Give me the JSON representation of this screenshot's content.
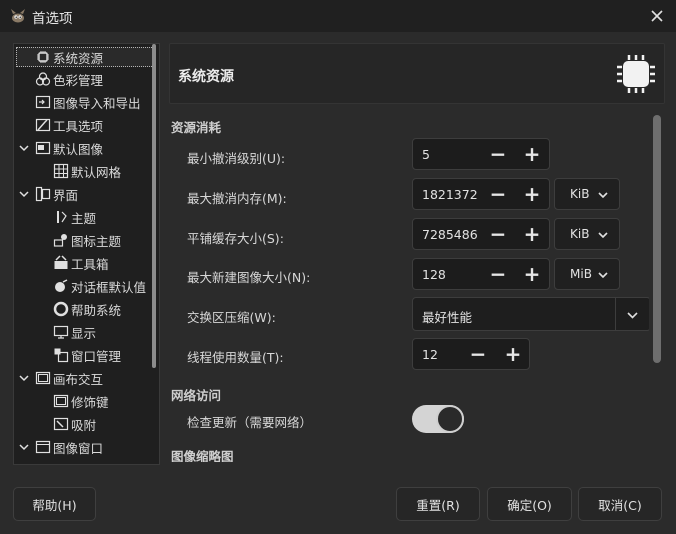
{
  "window": {
    "title": "首选项"
  },
  "tree": {
    "items": [
      {
        "label": "系统资源",
        "icon": "cpu-icon",
        "selected": true
      },
      {
        "label": "色彩管理",
        "icon": "color-circles-icon"
      },
      {
        "label": "图像导入和导出",
        "icon": "image-import-export-icon"
      },
      {
        "label": "工具选项",
        "icon": "tool-options-icon"
      },
      {
        "label": "默认图像",
        "icon": "default-image-icon",
        "expanded": true
      },
      {
        "label": "默认网格",
        "icon": "grid-icon"
      },
      {
        "label": "界面",
        "icon": "interface-icon",
        "expanded": true
      },
      {
        "label": "主题",
        "icon": "theme-icon"
      },
      {
        "label": "图标主题",
        "icon": "icon-theme-icon"
      },
      {
        "label": "工具箱",
        "icon": "toolbox-icon"
      },
      {
        "label": "对话框默认值",
        "icon": "dialog-defaults-icon"
      },
      {
        "label": "帮助系统",
        "icon": "help-lifebuoy-icon"
      },
      {
        "label": "显示",
        "icon": "display-monitor-icon"
      },
      {
        "label": "窗口管理",
        "icon": "window-management-icon"
      },
      {
        "label": "画布交互",
        "icon": "canvas-icon",
        "expanded": true
      },
      {
        "label": "修饰键",
        "icon": "modifier-keys-icon"
      },
      {
        "label": "吸附",
        "icon": "snapping-icon"
      },
      {
        "label": "图像窗口",
        "icon": "image-window-icon",
        "expanded": true
      }
    ]
  },
  "header": {
    "title": "系统资源",
    "icon": "cpu-chip-icon"
  },
  "resources": {
    "section_title": "资源消耗",
    "min_undo_label": "最小撤消级别(U):",
    "min_undo_value": "5",
    "max_undo_mem_label": "最大撤消内存(M):",
    "max_undo_mem_value": "1821372",
    "max_undo_mem_unit": "KiB",
    "tile_cache_label": "平铺缓存大小(S):",
    "tile_cache_value": "7285486",
    "tile_cache_unit": "KiB",
    "max_new_image_label": "最大新建图像大小(N):",
    "max_new_image_value": "128",
    "max_new_image_unit": "MiB",
    "swap_compress_label": "交换区压缩(W):",
    "swap_compress_value": "最好性能",
    "threads_label": "线程使用数量(T):",
    "threads_value": "12",
    "minus": "−",
    "plus": "+"
  },
  "network": {
    "section_title": "网络访问",
    "check_updates_label": "检查更新（需要网络）",
    "check_updates_on": true
  },
  "thumbnails": {
    "section_title": "图像缩略图"
  },
  "buttons": {
    "help": "帮助(H)",
    "reset": "重置(R)",
    "ok": "确定(O)",
    "cancel": "取消(C)"
  }
}
